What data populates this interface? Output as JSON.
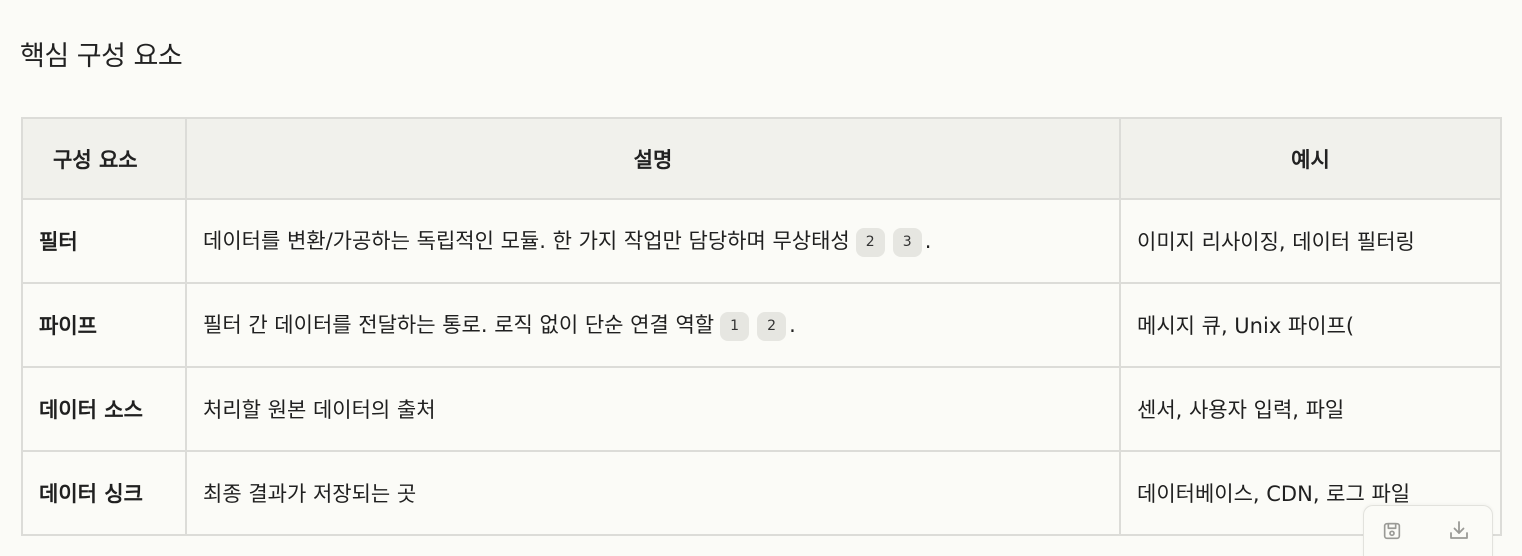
{
  "heading": "핵심 구성 요소",
  "table": {
    "headers": [
      "구성 요소",
      "설명",
      "예시"
    ],
    "rows": [
      {
        "component": "필터",
        "description": "데이터를 변환/가공하는 독립적인 모듈. 한 가지 작업만 담당하며 무상태성",
        "citations": [
          "2",
          "3"
        ],
        "tail": ".",
        "example": "이미지 리사이징, 데이터 필터링"
      },
      {
        "component": "파이프",
        "description": "필터 간 데이터를 전달하는 통로. 로직 없이 단순 연결 역할",
        "citations": [
          "1",
          "2"
        ],
        "tail": ".",
        "example": "메시지 큐, Unix 파이프("
      },
      {
        "component": "데이터 소스",
        "description": "처리할 원본 데이터의 출처",
        "citations": [],
        "tail": "",
        "example": "센서, 사용자 입력, 파일"
      },
      {
        "component": "데이터 싱크",
        "description": "최종 결과가 저장되는 곳",
        "citations": [],
        "tail": "",
        "example": "데이터베이스, CDN, 로그 파일"
      }
    ]
  },
  "toolbar": {
    "save_icon": "save-icon",
    "download_icon": "download-icon"
  }
}
